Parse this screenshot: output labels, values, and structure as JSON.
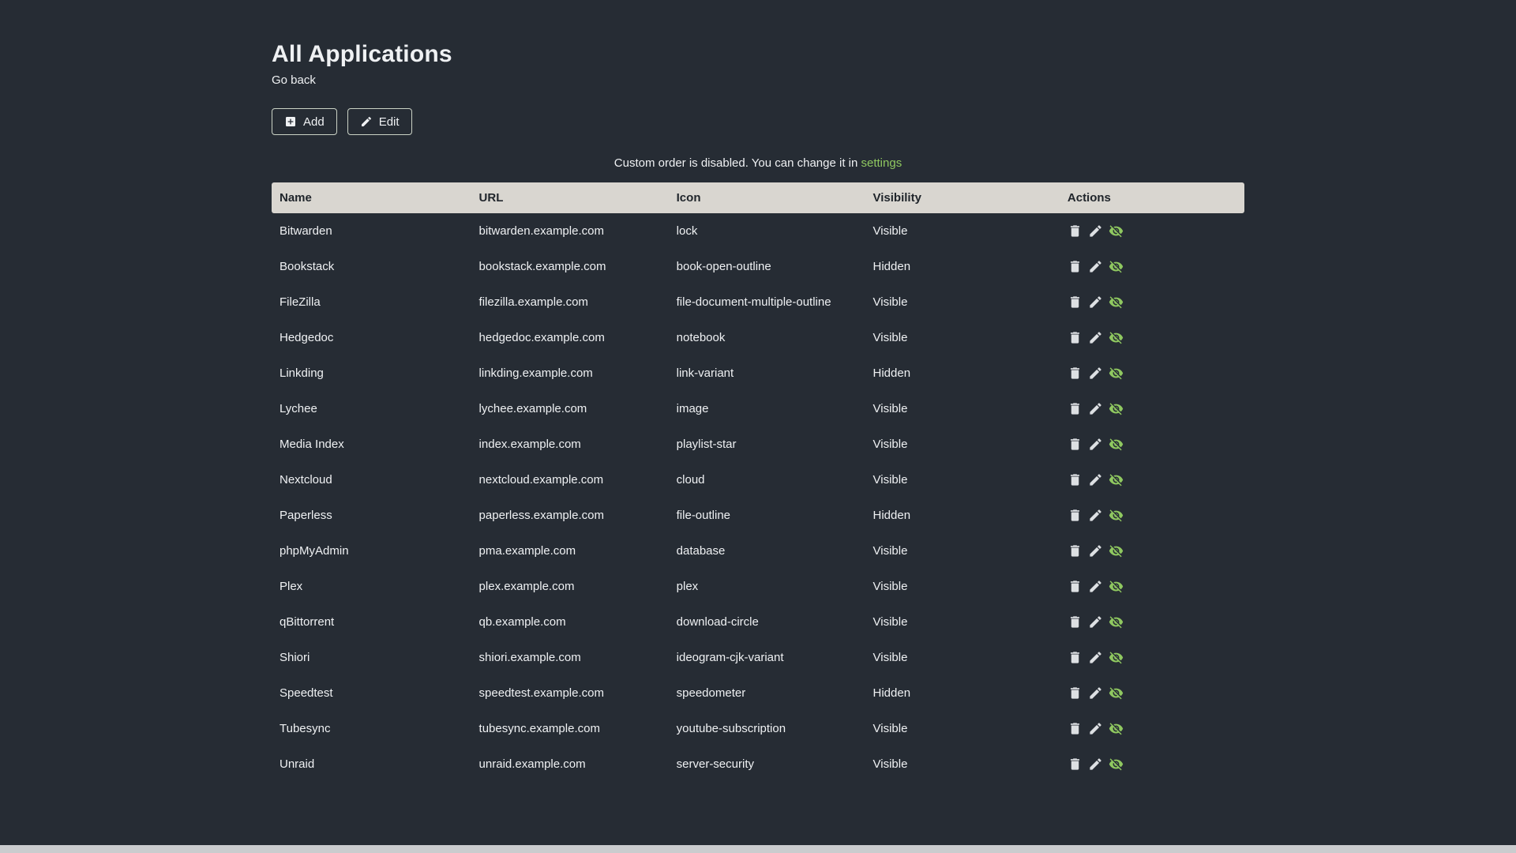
{
  "page": {
    "title": "All Applications",
    "back_link": "Go back",
    "notice_text": "Custom order is disabled. You can change it in ",
    "notice_link": "settings"
  },
  "toolbar": {
    "add_label": "Add",
    "edit_label": "Edit"
  },
  "table": {
    "headers": [
      "Name",
      "URL",
      "Icon",
      "Visibility",
      "Actions"
    ],
    "rows": [
      {
        "name": "Bitwarden",
        "url": "bitwarden.example.com",
        "icon": "lock",
        "visibility": "Visible"
      },
      {
        "name": "Bookstack",
        "url": "bookstack.example.com",
        "icon": "book-open-outline",
        "visibility": "Hidden"
      },
      {
        "name": "FileZilla",
        "url": "filezilla.example.com",
        "icon": "file-document-multiple-outline",
        "visibility": "Visible"
      },
      {
        "name": "Hedgedoc",
        "url": "hedgedoc.example.com",
        "icon": "notebook",
        "visibility": "Visible"
      },
      {
        "name": "Linkding",
        "url": "linkding.example.com",
        "icon": "link-variant",
        "visibility": "Hidden"
      },
      {
        "name": "Lychee",
        "url": "lychee.example.com",
        "icon": "image",
        "visibility": "Visible"
      },
      {
        "name": "Media Index",
        "url": "index.example.com",
        "icon": "playlist-star",
        "visibility": "Visible"
      },
      {
        "name": "Nextcloud",
        "url": "nextcloud.example.com",
        "icon": "cloud",
        "visibility": "Visible"
      },
      {
        "name": "Paperless",
        "url": "paperless.example.com",
        "icon": "file-outline",
        "visibility": "Hidden"
      },
      {
        "name": "phpMyAdmin",
        "url": "pma.example.com",
        "icon": "database",
        "visibility": "Visible"
      },
      {
        "name": "Plex",
        "url": "plex.example.com",
        "icon": "plex",
        "visibility": "Visible"
      },
      {
        "name": "qBittorrent",
        "url": "qb.example.com",
        "icon": "download-circle",
        "visibility": "Visible"
      },
      {
        "name": "Shiori",
        "url": "shiori.example.com",
        "icon": "ideogram-cjk-variant",
        "visibility": "Visible"
      },
      {
        "name": "Speedtest",
        "url": "speedtest.example.com",
        "icon": "speedometer",
        "visibility": "Hidden"
      },
      {
        "name": "Tubesync",
        "url": "tubesync.example.com",
        "icon": "youtube-subscription",
        "visibility": "Visible"
      },
      {
        "name": "Unraid",
        "url": "unraid.example.com",
        "icon": "server-security",
        "visibility": "Visible"
      }
    ]
  },
  "action_icons": [
    "trash-icon",
    "pencil-icon",
    "eye-off-icon"
  ],
  "colors": {
    "background": "#262c34",
    "header_bg": "#d9d6d0",
    "accent_green": "#8fc860",
    "text": "#eff1f3"
  }
}
